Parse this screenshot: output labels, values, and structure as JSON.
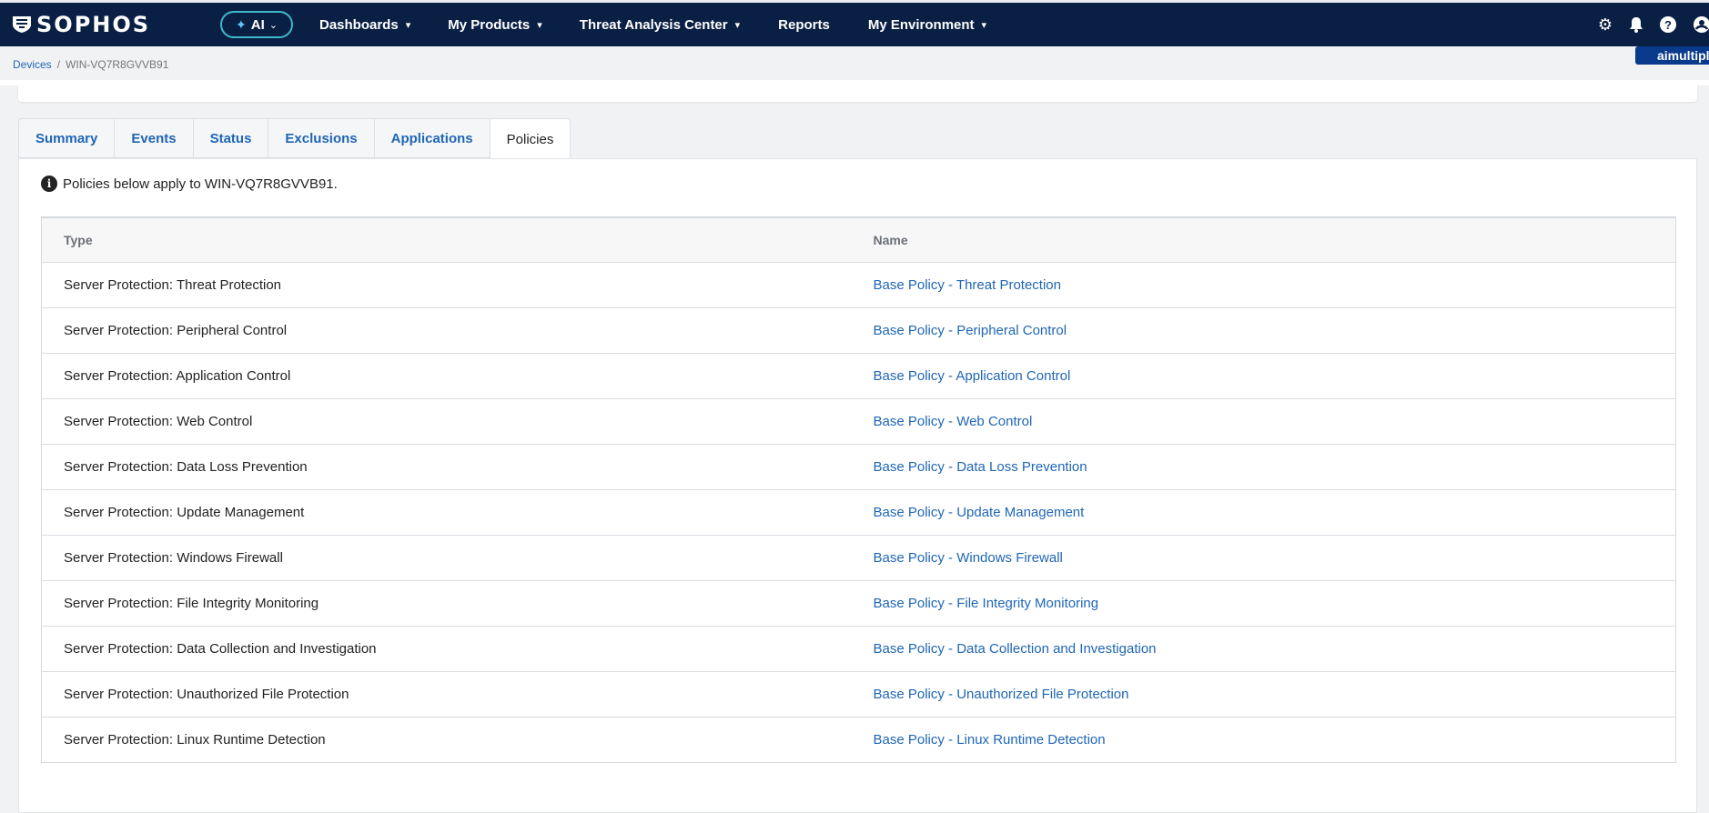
{
  "brand": {
    "logo_text": "SOPHOS"
  },
  "nav": {
    "ai_label": "AI",
    "items": [
      {
        "label": "Dashboards",
        "dropdown": true
      },
      {
        "label": "My Products",
        "dropdown": true
      },
      {
        "label": "Threat Analysis Center",
        "dropdown": true
      },
      {
        "label": "Reports",
        "dropdown": false
      },
      {
        "label": "My Environment",
        "dropdown": true
      }
    ],
    "right_icons": [
      "gear-icon",
      "bell-icon",
      "help-icon",
      "user-icon"
    ],
    "user_tag": "aimultipl"
  },
  "breadcrumb": {
    "root": "Devices",
    "separator": "/",
    "current": "WIN-VQ7R8GVVB91"
  },
  "tabs": [
    {
      "label": "Summary",
      "active": false
    },
    {
      "label": "Events",
      "active": false
    },
    {
      "label": "Status",
      "active": false
    },
    {
      "label": "Exclusions",
      "active": false
    },
    {
      "label": "Applications",
      "active": false
    },
    {
      "label": "Policies",
      "active": true
    }
  ],
  "policies": {
    "info_text": "Policies below apply to WIN-VQ7R8GVVB91.",
    "columns": {
      "type": "Type",
      "name": "Name"
    },
    "rows": [
      {
        "type": "Server Protection: Threat Protection",
        "name": "Base Policy - Threat Protection"
      },
      {
        "type": "Server Protection: Peripheral Control",
        "name": "Base Policy - Peripheral Control"
      },
      {
        "type": "Server Protection: Application Control",
        "name": "Base Policy - Application Control"
      },
      {
        "type": "Server Protection: Web Control",
        "name": "Base Policy - Web Control"
      },
      {
        "type": "Server Protection: Data Loss Prevention",
        "name": "Base Policy - Data Loss Prevention"
      },
      {
        "type": "Server Protection: Update Management",
        "name": "Base Policy - Update Management"
      },
      {
        "type": "Server Protection: Windows Firewall",
        "name": "Base Policy - Windows Firewall"
      },
      {
        "type": "Server Protection: File Integrity Monitoring",
        "name": "Base Policy - File Integrity Monitoring"
      },
      {
        "type": "Server Protection: Data Collection and Investigation",
        "name": "Base Policy - Data Collection and Investigation"
      },
      {
        "type": "Server Protection: Unauthorized File Protection",
        "name": "Base Policy - Unauthorized File Protection"
      },
      {
        "type": "Server Protection: Linux Runtime Detection",
        "name": "Base Policy - Linux Runtime Detection"
      }
    ]
  }
}
